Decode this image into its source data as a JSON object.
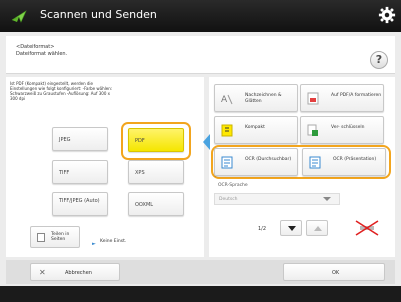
{
  "window": {
    "title": "Scannen und Senden"
  },
  "header": {
    "line1": "<Dateiformat>",
    "line2": "Dateiformat wählen."
  },
  "help_label": "?",
  "info_text": "Ist PDF (Kompakt) eingestellt, werden die Einstellungen wie folgt konfiguriert: -Farbe wählen: Schwarzweiß zu Graustufen -Auflösung: Auf 300 x 300 dpi",
  "formats": [
    {
      "label": "JPEG",
      "selected": false
    },
    {
      "label": "PDF",
      "selected": true
    },
    {
      "label": "TIFF",
      "selected": false
    },
    {
      "label": "XPS",
      "selected": false
    },
    {
      "label": "TIFF/JPEG (Auto)",
      "selected": false
    },
    {
      "label": "OOXML",
      "selected": false
    }
  ],
  "split": {
    "label": "Teilen in Seiten",
    "value": "Keine Einst."
  },
  "options": [
    {
      "label": "Nachzeichnen & Glätten"
    },
    {
      "label": "Auf PDF/A formatieren"
    },
    {
      "label": "Kompakt"
    },
    {
      "label": "Ver- schlüsseln"
    },
    {
      "label": "OCR (Durchsuchbar)"
    },
    {
      "label": "OCR (Präsentation)"
    }
  ],
  "ocr_language": {
    "label": "OCR-Sprache",
    "value": "Deutsch"
  },
  "pagination": {
    "text": "1/2"
  },
  "footer_buttons": {
    "cancel": "Abbrechen",
    "ok": "OK"
  },
  "colors": {
    "accent_orange": "#f2a51e",
    "selected_yellow": "#f5e600",
    "arrow_blue": "#4aa3e0"
  }
}
